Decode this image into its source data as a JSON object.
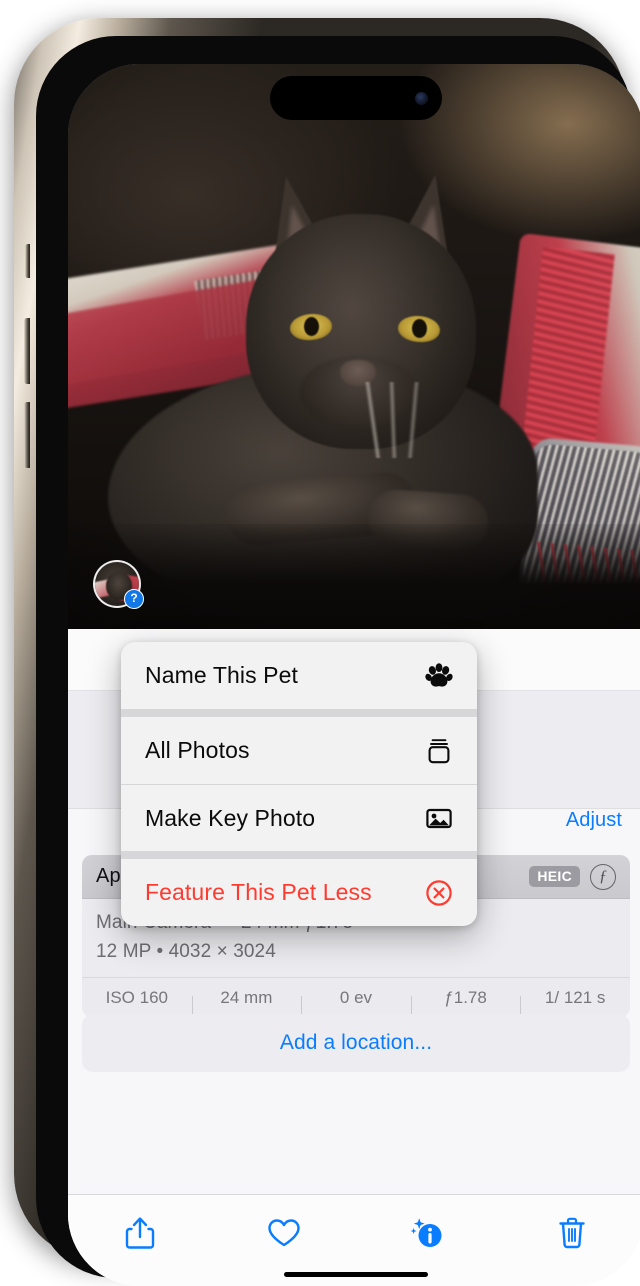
{
  "device": {
    "name": "iPhone 14 Pro",
    "dynamic_island": "dynamic-island",
    "front_camera": "front-camera-icon"
  },
  "photo": {
    "subject": "black cat lying on red and white blanket",
    "pet_chip": {
      "badge_glyph": "?",
      "badge_meaning": "unnamed-pet",
      "badge_color": "#1278e8"
    }
  },
  "context_menu": {
    "groups": [
      {
        "items": [
          {
            "label": "Name This Pet",
            "icon": "paw-icon",
            "destructive": false
          }
        ]
      },
      {
        "items": [
          {
            "label": "All Photos",
            "icon": "photo-stack-icon",
            "destructive": false
          },
          {
            "label": "Make Key Photo",
            "icon": "photo-icon",
            "destructive": false
          }
        ]
      },
      {
        "items": [
          {
            "label": "Feature This Pet Less",
            "icon": "x-circle-icon",
            "destructive": true
          }
        ]
      }
    ],
    "destructive_color": "#ff3b30"
  },
  "info_sheet": {
    "adjust_label": "Adjust",
    "accent_color": "#0a7cff",
    "exif": {
      "device_name": "Apple iPhone 14 Pro",
      "format_badge": "HEIC",
      "f_icon": "f-circle-icon",
      "lens_line": "Main Camera  —  24 mm  ƒ1.78",
      "resolution_line": "12 MP  •  4032 × 3024",
      "stats": [
        {
          "label": "ISO 160"
        },
        {
          "label": "24 mm"
        },
        {
          "label": "0 ev"
        },
        {
          "label": "ƒ1.78"
        },
        {
          "label": "1/ 121 s"
        }
      ]
    },
    "add_location_label": "Add a location..."
  },
  "toolbar": {
    "items": [
      {
        "name": "share-icon",
        "label": "Share"
      },
      {
        "name": "heart-icon",
        "label": "Favorite"
      },
      {
        "name": "info-sparkle-icon",
        "label": "Info"
      },
      {
        "name": "trash-icon",
        "label": "Delete"
      }
    ],
    "accent_color": "#0a7cff"
  }
}
